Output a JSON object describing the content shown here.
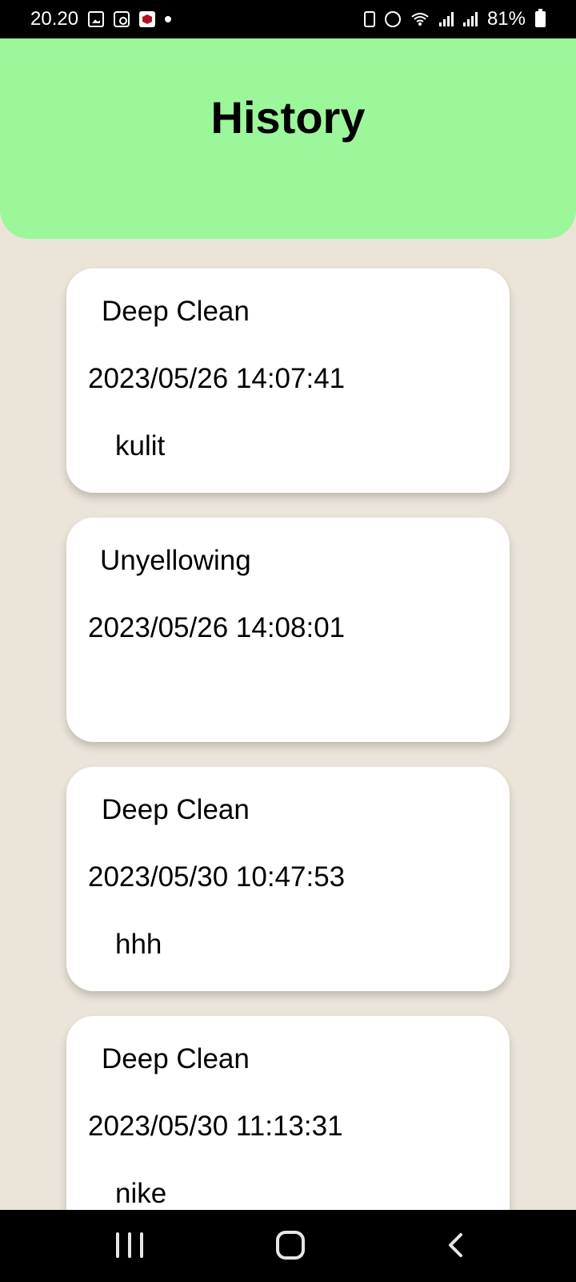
{
  "status_bar": {
    "time": "20.20",
    "battery_percent": "81%",
    "icons_left": [
      "gallery-icon",
      "clock-widget-icon",
      "app-icon",
      "notification-dot"
    ],
    "icons_right": [
      "battery-saver-icon",
      "alarm-icon",
      "wifi-icon",
      "signal-icon",
      "signal-icon",
      "battery-icon"
    ]
  },
  "header": {
    "title": "History",
    "bg_color": "#9CF79A"
  },
  "history": [
    {
      "type": "Deep Clean",
      "datetime": "2023/05/26 14:07:41",
      "note": "kulit"
    },
    {
      "type": "Unyellowing",
      "datetime": "2023/05/26 14:08:01",
      "note": ""
    },
    {
      "type": "Deep Clean",
      "datetime": "2023/05/30 10:47:53",
      "note": "hhh"
    },
    {
      "type": "Deep Clean",
      "datetime": "2023/05/30 11:13:31",
      "note": "nike"
    }
  ],
  "nav_bar": {
    "buttons": [
      "recent-apps-icon",
      "home-icon",
      "back-icon"
    ]
  },
  "colors": {
    "background": "#EBE4D9",
    "card": "#FFFFFF",
    "header": "#9CF79A"
  }
}
